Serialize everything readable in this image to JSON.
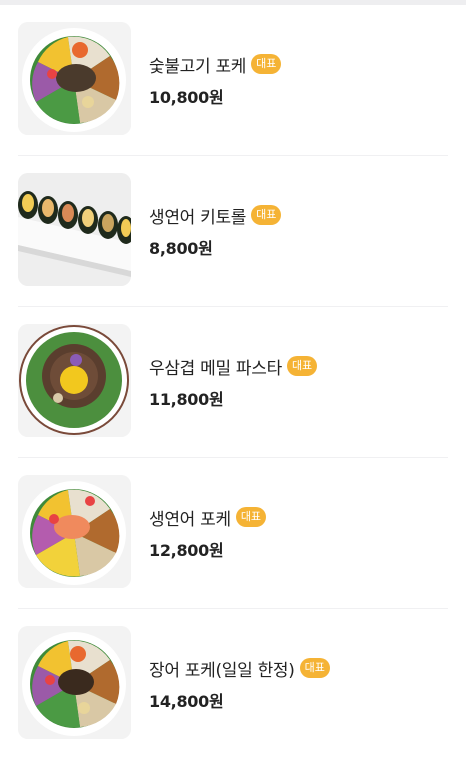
{
  "menu": {
    "items": [
      {
        "name": "숯불고기 포케",
        "badge": "대표",
        "price": "10,800원",
        "image": "poke-bowl-grilled-meat-photo"
      },
      {
        "name": "생연어 키토롤",
        "badge": "대표",
        "price": "8,800원",
        "image": "kimbap-rolls-on-plate-photo"
      },
      {
        "name": "우삼겹 메밀 파스타",
        "badge": "대표",
        "price": "11,800원",
        "image": "buckwheat-pasta-plate-photo"
      },
      {
        "name": "생연어 포케",
        "badge": "대표",
        "price": "12,800원",
        "image": "salmon-poke-bowl-photo"
      },
      {
        "name": "장어 포케(일일 한정)",
        "badge": "대표",
        "price": "14,800원",
        "image": "eel-poke-bowl-photo"
      }
    ]
  },
  "colors": {
    "badge": "#f5b335",
    "text": "#222222",
    "divider": "#f0f0f2"
  }
}
